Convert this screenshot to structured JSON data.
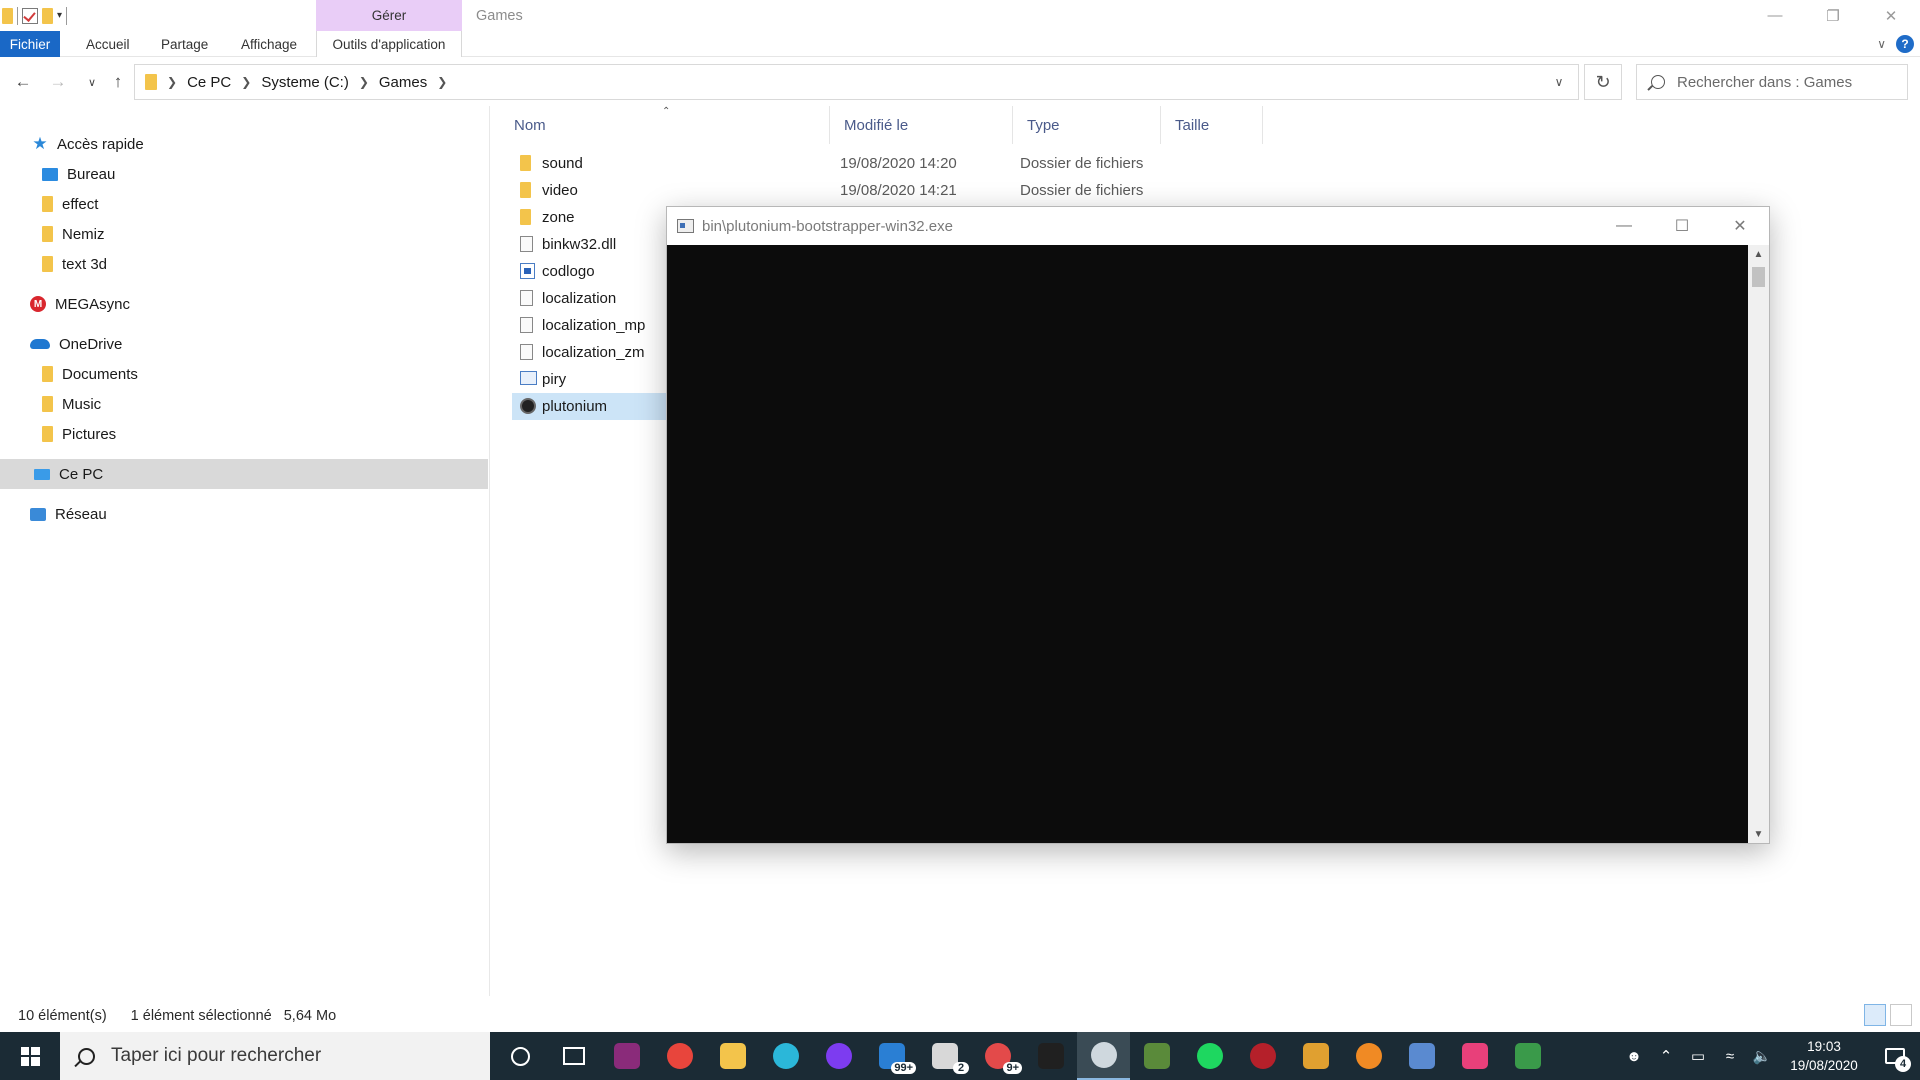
{
  "explorer": {
    "window_title": "Games",
    "contextual_group": "Gérer",
    "ribbon_tabs": [
      "Fichier",
      "Accueil",
      "Partage",
      "Affichage",
      "Outils d'application"
    ],
    "address": {
      "crumbs": [
        "Ce PC",
        "Systeme (C:)",
        "Games"
      ]
    },
    "search_placeholder": "Rechercher dans : Games",
    "nav": {
      "quick_access": "Accès rapide",
      "quick_items": [
        "Bureau",
        "effect",
        "Nemiz",
        "text 3d"
      ],
      "mega": "MEGAsync",
      "onedrive": "OneDrive",
      "onedrive_items": [
        "Documents",
        "Music",
        "Pictures"
      ],
      "this_pc": "Ce PC",
      "network": "Réseau"
    },
    "columns": {
      "name": "Nom",
      "modified": "Modifié le",
      "type": "Type",
      "size": "Taille"
    },
    "files": [
      {
        "name": "sound",
        "date": "19/08/2020 14:20",
        "type": "Dossier de fichiers",
        "icon": "folder-icon"
      },
      {
        "name": "video",
        "date": "19/08/2020 14:21",
        "type": "Dossier de fichiers",
        "icon": "folder-icon"
      },
      {
        "name": "zone",
        "date": "",
        "type": "",
        "icon": "folder-icon"
      },
      {
        "name": "binkw32.dll",
        "date": "",
        "type": "",
        "icon": "file-icon"
      },
      {
        "name": "codlogo",
        "date": "",
        "type": "",
        "icon": "image-file-icon"
      },
      {
        "name": "localization",
        "date": "",
        "type": "",
        "icon": "file-icon"
      },
      {
        "name": "localization_mp",
        "date": "",
        "type": "",
        "icon": "file-icon"
      },
      {
        "name": "localization_zm",
        "date": "",
        "type": "",
        "icon": "file-icon"
      },
      {
        "name": "piry",
        "date": "",
        "type": "",
        "icon": "exe-icon"
      },
      {
        "name": "plutonium",
        "date": "",
        "type": "",
        "icon": "plutonium-icon"
      }
    ],
    "status": {
      "count": "10 élément(s)",
      "selected": "1 élément sélectionné",
      "size": "5,64 Mo"
    }
  },
  "console": {
    "title": "bin\\plutonium-bootstrapper-win32.exe"
  },
  "taskbar": {
    "search_placeholder": "Taper ici pour rechercher",
    "apps": [
      {
        "name": "cortana-icon",
        "color": "#ffffff"
      },
      {
        "name": "task-view-icon",
        "color": "#ffffff"
      },
      {
        "name": "winrar-icon",
        "color": "#8a2b7a"
      },
      {
        "name": "chrome-icon",
        "color": "#e8453c"
      },
      {
        "name": "file-explorer-icon",
        "color": "#f3c44b"
      },
      {
        "name": "edge-icon",
        "color": "#2bb7d9"
      },
      {
        "name": "podcast-icon",
        "color": "#7d3cf0"
      },
      {
        "name": "mail-icon",
        "color": "#2a7fd4",
        "badge": "99+"
      },
      {
        "name": "stack-icon",
        "color": "#d8d8d8",
        "badge": "2"
      },
      {
        "name": "discord-icon",
        "color": "#e34a4a",
        "badge": "9+"
      },
      {
        "name": "skull-app-icon",
        "color": "#202020"
      },
      {
        "name": "plutonium-app-icon",
        "color": "#cfd8de"
      },
      {
        "name": "minecraft-icon",
        "color": "#5a8a3a"
      },
      {
        "name": "spotify-icon",
        "color": "#1ed760"
      },
      {
        "name": "redcircle-icon",
        "color": "#b5202a"
      },
      {
        "name": "csgo-icon",
        "color": "#e0a030"
      },
      {
        "name": "origin-icon",
        "color": "#f08a24"
      },
      {
        "name": "photo-app-icon",
        "color": "#5a8ad0"
      },
      {
        "name": "pink-app-icon",
        "color": "#e8407a"
      },
      {
        "name": "console-app-icon",
        "color": "#3a9a4a"
      }
    ],
    "clock_time": "19:03",
    "clock_date": "19/08/2020",
    "notifications": "4"
  }
}
